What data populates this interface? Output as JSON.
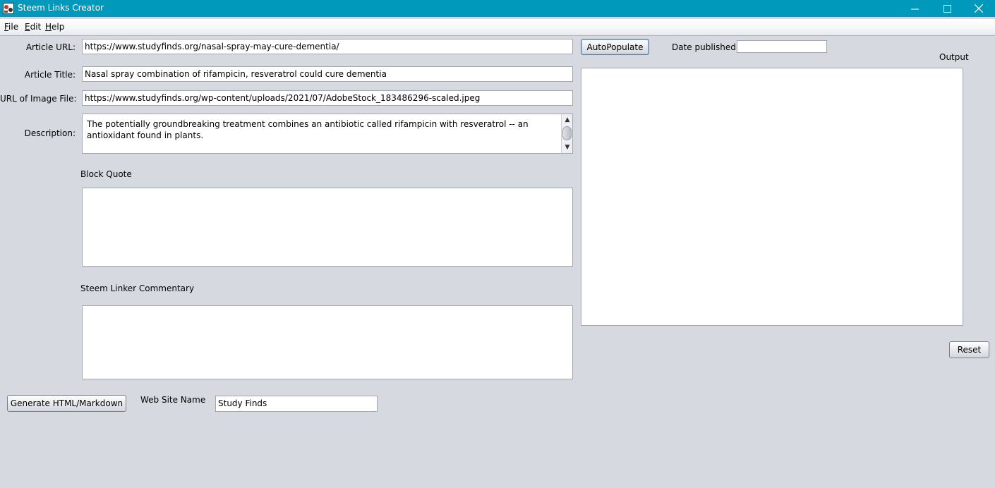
{
  "window": {
    "title": "Steem Links Creator",
    "icon": "app-logo-icon"
  },
  "menu": {
    "file": {
      "mnemonic": "F",
      "rest": "ile"
    },
    "edit": {
      "mnemonic": "E",
      "rest": "dit"
    },
    "help": {
      "mnemonic": "H",
      "rest": "elp"
    }
  },
  "form": {
    "article_url": {
      "label": "Article URL:",
      "value": "https://www.studyfinds.org/nasal-spray-may-cure-dementia/"
    },
    "article_title": {
      "label": "Article Title:",
      "value": "Nasal spray combination of rifampicin, resveratrol could cure dementia"
    },
    "image_url": {
      "label": "URL of Image File:",
      "value": "https://www.studyfinds.org/wp-content/uploads/2021/07/AdobeStock_183486296-scaled.jpeg"
    },
    "description": {
      "label": "Description:",
      "value": "The potentially groundbreaking treatment combines an antibiotic called rifampicin with resveratrol -- an antioxidant found in plants."
    },
    "block_quote": {
      "label": "Block Quote",
      "value": ""
    },
    "commentary": {
      "label": "Steem Linker Commentary",
      "value": ""
    },
    "website_name": {
      "label": "Web Site Name",
      "value": "Study Finds"
    },
    "date_published": {
      "label": "Date published",
      "value": ""
    }
  },
  "buttons": {
    "autopopulate": "AutoPopulate",
    "generate": "Generate HTML/Markdown",
    "reset": "Reset"
  },
  "output": {
    "label": "Output",
    "value": ""
  },
  "colors": {
    "titlebar": "#0099bb",
    "background": "#d6d9df"
  }
}
